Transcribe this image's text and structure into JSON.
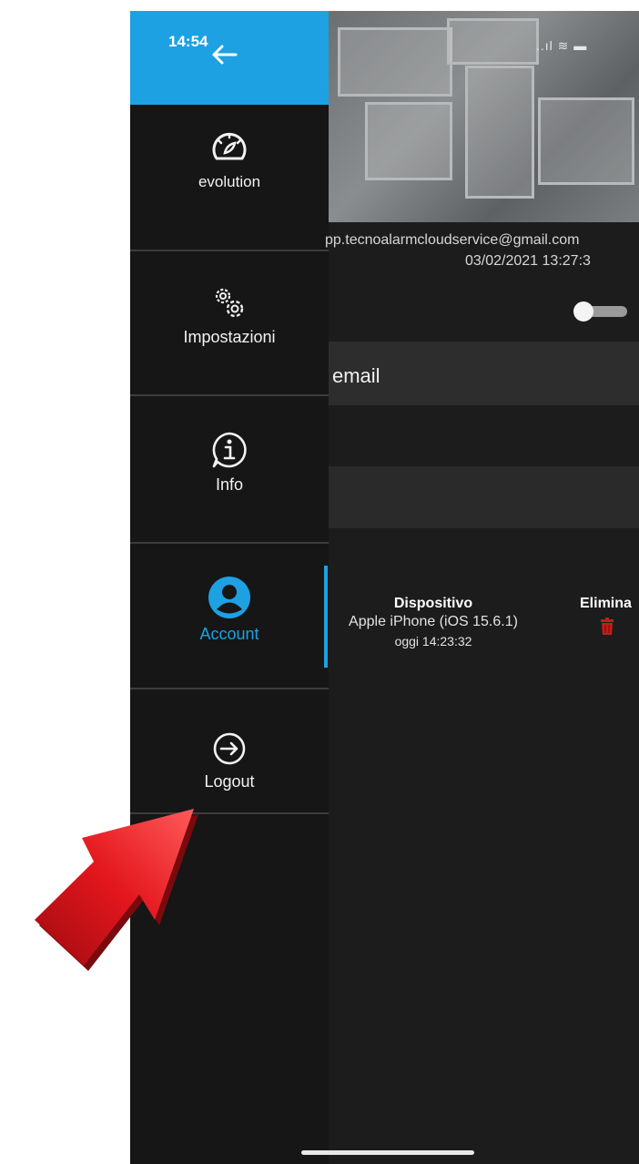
{
  "status_bar": {
    "time": "14:54",
    "signal_icons": "..ıl ≋ ▬"
  },
  "sidebar": {
    "items": [
      {
        "label": "evolution",
        "icon": "speedometer-icon"
      },
      {
        "label": "Impostazioni",
        "icon": "gears-icon"
      },
      {
        "label": "Info",
        "icon": "info-icon"
      },
      {
        "label": "Account",
        "icon": "account-icon",
        "active": true
      },
      {
        "label": "Logout",
        "icon": "logout-icon"
      }
    ]
  },
  "account": {
    "email": "pp.tecnoalarmcloudservice@gmail.com",
    "date": "03/02/2021 13:27:3",
    "email_section_label": "email"
  },
  "devices": {
    "column_device": "Dispositivo",
    "column_delete": "Elimina",
    "rows": [
      {
        "name": "Apple iPhone (iOS 15.6.1)",
        "last_seen": "oggi 14:23:32"
      }
    ]
  },
  "colors": {
    "accent": "#1da1e3",
    "annotation_arrow": "#d9141b",
    "delete": "#c41c1c"
  }
}
